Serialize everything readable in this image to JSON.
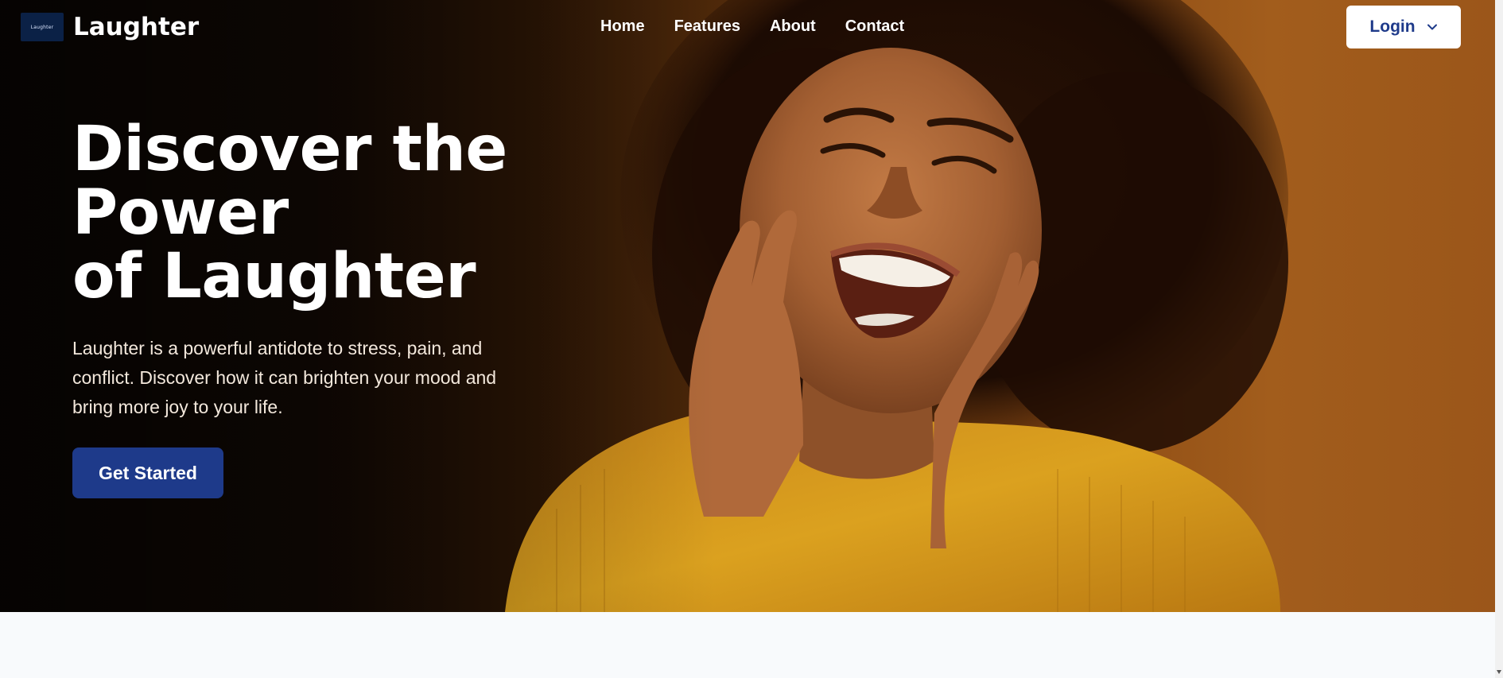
{
  "brand": {
    "logo_text": "Laughter",
    "name": "Laughter"
  },
  "nav": {
    "links": [
      "Home",
      "Features",
      "About",
      "Contact"
    ]
  },
  "login": {
    "label": "Login",
    "icon": "chevron-down-icon"
  },
  "hero": {
    "title_lines": [
      "Discover the",
      "Power",
      "of Laughter"
    ],
    "subtitle": "Laughter is a powerful antidote to stress, pain, and conflict. Discover how it can brighten your mood and bring more joy to your life.",
    "cta_label": "Get Started",
    "image": "laughing-woman-photo"
  },
  "colors": {
    "primary": "#1e3a8a",
    "hero_dark": "#0c0704",
    "hero_warm": "#a25d1c",
    "sweater": "#d99a1c",
    "page_bg": "#f8fafc"
  }
}
